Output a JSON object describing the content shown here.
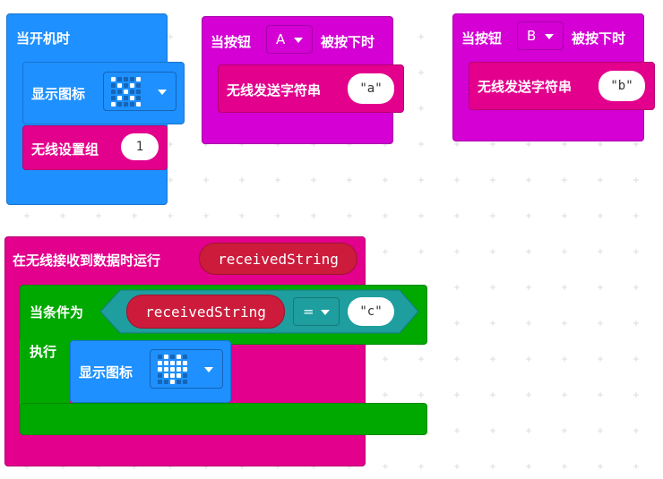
{
  "colors": {
    "basic": "#1e90ff",
    "basic_dark": "#1875d1",
    "input": "#d400d4",
    "radio": "#e3008c",
    "radio_dark": "#b5006f",
    "logic": "#00a900",
    "logic_dark": "#008800",
    "compare": "#1e9e9e",
    "variable": "#cc1b3b",
    "grid_plus": "#d8dde6"
  },
  "on_start": {
    "header": "当开机时",
    "show_icon_label": "显示图标",
    "show_icon_dropdown": "cross-icon",
    "radio_group_label": "无线设置组",
    "radio_group_value": "1"
  },
  "button_a": {
    "header_prefix": "当按钮",
    "button_value": "A",
    "header_suffix": "被按下时",
    "send_label": "无线发送字符串",
    "send_value": "\"a\""
  },
  "button_b": {
    "header_prefix": "当按钮",
    "button_value": "B",
    "header_suffix": "被按下时",
    "send_label": "无线发送字符串",
    "send_value": "\"b\""
  },
  "on_received": {
    "header": "在无线接收到数据时运行",
    "param": "receivedString",
    "if_label": "当条件为",
    "compare_left": "receivedString",
    "operator": "=",
    "compare_right": "\"c\"",
    "do_label": "执行",
    "show_icon_label": "显示图标",
    "show_icon_dropdown": "heart-icon"
  },
  "icons": {
    "cross": [
      1,
      0,
      0,
      0,
      1,
      0,
      1,
      0,
      1,
      0,
      0,
      0,
      1,
      0,
      0,
      0,
      1,
      0,
      1,
      0,
      1,
      0,
      0,
      0,
      1
    ],
    "heart": [
      0,
      1,
      0,
      1,
      0,
      1,
      1,
      1,
      1,
      1,
      1,
      1,
      1,
      1,
      1,
      0,
      1,
      1,
      1,
      0,
      0,
      0,
      1,
      0,
      0
    ]
  }
}
